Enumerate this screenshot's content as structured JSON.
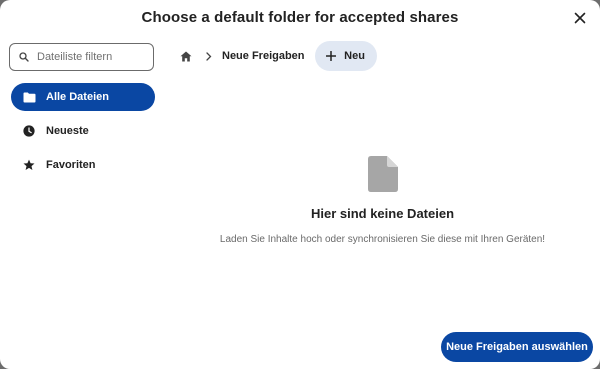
{
  "dialog": {
    "title": "Choose a default folder for accepted shares",
    "close_icon": "close-icon"
  },
  "sidebar": {
    "filter_placeholder": "Dateiliste filtern",
    "items": [
      {
        "label": "Alle Dateien",
        "icon": "folder-icon",
        "active": true
      },
      {
        "label": "Neueste",
        "icon": "clock-icon",
        "active": false
      },
      {
        "label": "Favoriten",
        "icon": "star-icon",
        "active": false
      }
    ]
  },
  "breadcrumb": {
    "home_icon": "home-icon",
    "current": "Neue Freigaben",
    "new_label": "Neu"
  },
  "empty_state": {
    "icon": "file-icon",
    "title": "Hier sind keine Dateien",
    "message": "Laden Sie Inhalte hoch oder synchronisieren Sie diese mit Ihren Geräten!"
  },
  "footer": {
    "primary_label": "Neue Freigaben auswählen"
  },
  "colors": {
    "accent": "#0a47a3",
    "new_button_bg": "#e1e8f3",
    "backdrop": "#6d6d6d"
  }
}
